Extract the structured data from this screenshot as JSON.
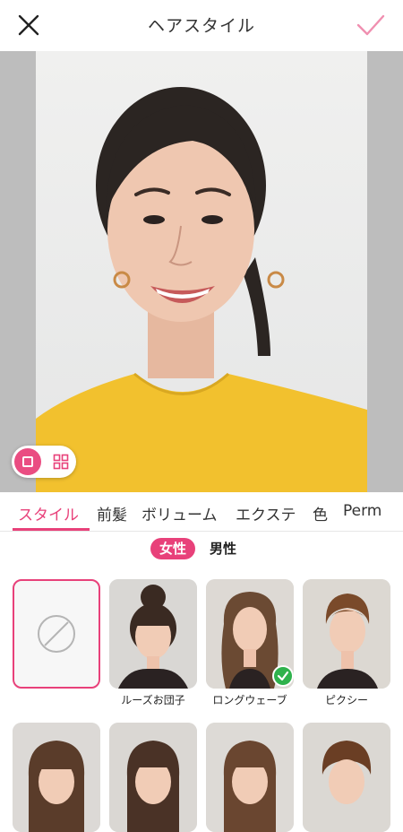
{
  "header": {
    "title": "ヘアスタイル",
    "close_icon": "close-x-icon",
    "confirm_icon": "checkmark-icon",
    "accent": "#e8417a"
  },
  "photo": {
    "subject": "portrait-photo",
    "view_modes": [
      "single",
      "grid"
    ],
    "active_view": "single"
  },
  "tabs": [
    {
      "label": "スタイル",
      "active": true
    },
    {
      "label": "前髪"
    },
    {
      "label": "ボリューム"
    },
    {
      "label": "エクステ"
    },
    {
      "label": "色"
    },
    {
      "label": "Perm"
    }
  ],
  "gender": {
    "female": "女性",
    "male": "男性",
    "selected": "female"
  },
  "styles": [
    {
      "label": "",
      "type": "none",
      "selected": false
    },
    {
      "label": "ルーズお団子",
      "selected": false
    },
    {
      "label": "ロングウェーブ",
      "selected": true
    },
    {
      "label": "ピクシー",
      "selected": false
    }
  ],
  "colors": {
    "accent": "#e8417a",
    "check": "#2fb24c",
    "shirt": "#f2c12e"
  }
}
